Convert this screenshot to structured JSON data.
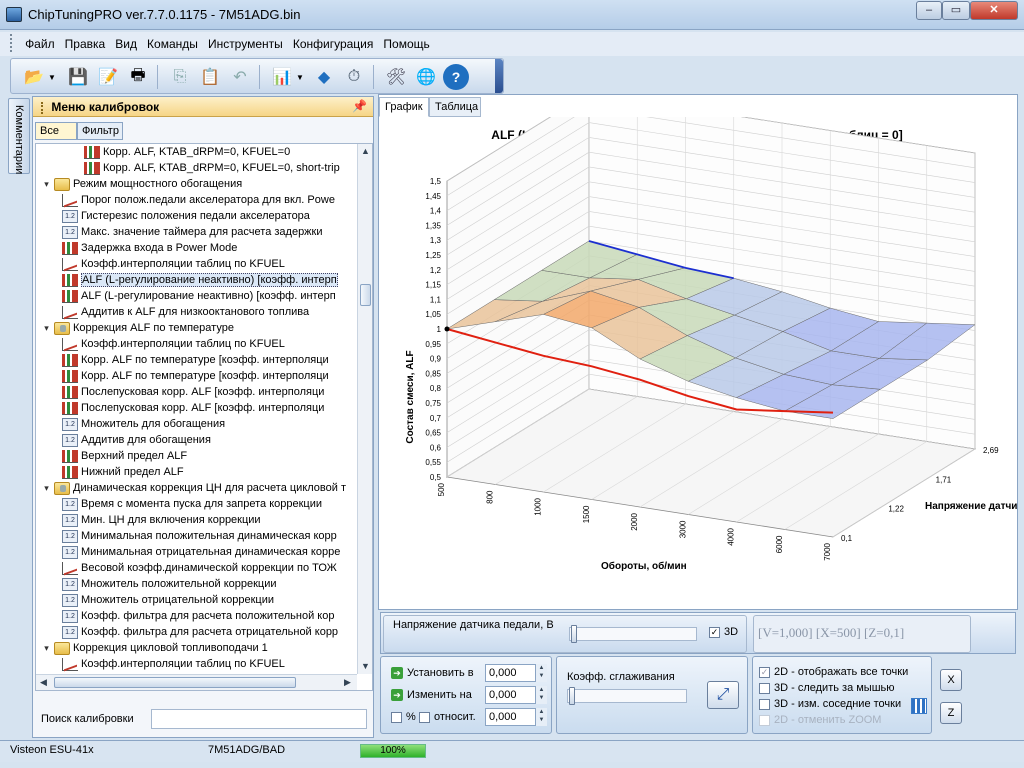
{
  "window": {
    "title": "ChipTuningPRO ver.7.7.0.1175 - 7M51ADG.bin"
  },
  "menu": [
    "Файл",
    "Правка",
    "Вид",
    "Команды",
    "Инструменты",
    "Конфигурация",
    "Помощь"
  ],
  "left_tab": "Комментарии",
  "calib_menu": {
    "title": "Меню калибровок",
    "tabs": [
      "Все",
      "Фильтр"
    ],
    "items": [
      {
        "text": "Корр. ALF, KTAB_dRPM=0, KFUEL=0",
        "icon": "bar-chart-icon",
        "level": 2
      },
      {
        "text": "Корр. ALF, KTAB_dRPM=0, KFUEL=0, short-trip",
        "icon": "bar-chart-icon",
        "level": 2
      },
      {
        "text": "Режим мощностного обогащения",
        "icon": "folder-icon",
        "level": 0,
        "toggle": "-"
      },
      {
        "text": "Порог полож.педали акселератора для вкл. Powe",
        "icon": "graph-icon",
        "level": 1
      },
      {
        "text": "Гистерезис положения педали акселератора",
        "icon": "number-icon",
        "level": 1
      },
      {
        "text": "Макс. значение таймера для расчета задержки",
        "icon": "number-icon",
        "level": 1
      },
      {
        "text": "Задержка входа в Power Mode",
        "icon": "bar-chart-icon",
        "level": 1
      },
      {
        "text": "Коэфф.интерполяции таблиц по KFUEL",
        "icon": "graph-icon",
        "level": 1
      },
      {
        "text": "ALF (L-регулирование неактивно)  [коэфф. интерп",
        "icon": "bar-chart-icon",
        "level": 1,
        "selected": true
      },
      {
        "text": "ALF (L-регулирование неактивно)  [коэфф. интерп",
        "icon": "bar-chart-icon",
        "level": 1
      },
      {
        "text": "Аддитив к ALF для низкооктанового топлива",
        "icon": "graph-icon",
        "level": 1
      },
      {
        "text": "Коррекция ALF по температуре",
        "icon": "folder-db-icon",
        "level": 0,
        "toggle": "-"
      },
      {
        "text": "Коэфф.интерполяции таблиц по KFUEL",
        "icon": "graph-icon",
        "level": 1
      },
      {
        "text": "Корр. ALF по температуре  [коэфф. интерполяци",
        "icon": "bar-chart-icon",
        "level": 1
      },
      {
        "text": "Корр. ALF по температуре  [коэфф. интерполяци",
        "icon": "bar-chart-icon",
        "level": 1
      },
      {
        "text": "Послепусковая корр. ALF  [коэфф. интерполяци",
        "icon": "bar-chart-icon",
        "level": 1
      },
      {
        "text": "Послепусковая корр. ALF  [коэфф. интерполяци",
        "icon": "bar-chart-icon",
        "level": 1
      },
      {
        "text": "Множитель для обогащения",
        "icon": "number-icon",
        "level": 1
      },
      {
        "text": "Аддитив для обогащения",
        "icon": "number-icon",
        "level": 1
      },
      {
        "text": "Верхний предел ALF",
        "icon": "bar-chart-icon",
        "level": 1
      },
      {
        "text": "Нижний предел ALF",
        "icon": "bar-chart-icon",
        "level": 1
      },
      {
        "text": "Динамическая коррекция ЦН для расчета цикловой т",
        "icon": "folder-db-icon",
        "level": 0,
        "toggle": "-"
      },
      {
        "text": "Время с момента пуска для запрета коррекции",
        "icon": "number-icon",
        "level": 1
      },
      {
        "text": "Мин. ЦН для включения коррекции",
        "icon": "number-icon",
        "level": 1
      },
      {
        "text": "Минимальная положительная динамическая корр",
        "icon": "number-icon",
        "level": 1
      },
      {
        "text": "Минимальная отрицательная динамическая корре",
        "icon": "number-icon",
        "level": 1
      },
      {
        "text": "Весовой коэфф.динамической коррекции по ТОЖ",
        "icon": "graph-icon",
        "level": 1
      },
      {
        "text": "Множитель положительной коррекции",
        "icon": "number-icon",
        "level": 1
      },
      {
        "text": "Множитель отрицательной коррекции",
        "icon": "number-icon",
        "level": 1
      },
      {
        "text": "Коэфф. фильтра для расчета  положительной кор",
        "icon": "number-icon",
        "level": 1
      },
      {
        "text": "Коэфф. фильтра для расчета отрицательной корр",
        "icon": "number-icon",
        "level": 1
      },
      {
        "text": "Коррекция цикловой топливоподачи 1",
        "icon": "folder-icon",
        "level": 0,
        "toggle": "-"
      },
      {
        "text": "Коэфф.интерполяции таблиц по KFUEL",
        "icon": "graph-icon",
        "level": 1
      }
    ],
    "search_label": "Поиск калибровки",
    "search_value": ""
  },
  "chart_tabs": [
    "График",
    "Таблица"
  ],
  "chart_data": {
    "type": "surface3d",
    "title": "ALF (L-регулирование неактивно)  [коэфф. интерполяции таблиц = 0]",
    "xlabel": "Обороты, об/мин",
    "ylabel": "Состав смеси, ALF",
    "zlabel": "Напряжение датчика педали, В",
    "x_ticks": [
      "500",
      "800",
      "1000",
      "1500",
      "2000",
      "3000",
      "4000",
      "6000",
      "7000"
    ],
    "y_ticks": [
      "0,5",
      "0,55",
      "0,6",
      "0,65",
      "0,7",
      "0,75",
      "0,8",
      "0,85",
      "0,9",
      "0,95",
      "1",
      "1,05",
      "1,1",
      "1,15",
      "1,2",
      "1,25",
      "1,3",
      "1,35",
      "1,4",
      "1,45",
      "1,5"
    ],
    "z_ticks": [
      "0,1",
      "1,22",
      "1,71",
      "2,69"
    ],
    "ylim": [
      0.5,
      1.5
    ],
    "surface_rows": [
      [
        1.0,
        1.05,
        1.1,
        1.08,
        1.0,
        0.95,
        0.92,
        0.9,
        0.9
      ],
      [
        1.0,
        1.02,
        1.08,
        1.05,
        0.98,
        0.93,
        0.9,
        0.89,
        0.9
      ],
      [
        1.0,
        1.0,
        1.02,
        0.98,
        0.95,
        0.92,
        0.88,
        0.88,
        0.9
      ],
      [
        1.0,
        0.98,
        0.96,
        0.95,
        0.93,
        0.9,
        0.88,
        0.9,
        0.92
      ]
    ],
    "highlight_line": {
      "name": "",
      "values": [
        1.0,
        0.98,
        0.96,
        0.95,
        0.93,
        0.9,
        0.88,
        0.9,
        0.92
      ]
    }
  },
  "controls": {
    "pedal_label": "Напряжение датчика педали, В",
    "check_3d": "3D",
    "readout": "[V=1,000]  [X=500]  [Z=0,1]",
    "set_label": "Установить в",
    "change_label": "Изменить на",
    "set_value": "0,000",
    "change_value": "0,000",
    "pct_label": "%",
    "rel_label": "относит.",
    "rel_value": "0,000",
    "smooth_label": "Коэфф. сглаживания",
    "opt1": "2D - отображать все точки",
    "opt2": "3D - следить за мышью",
    "opt3": "3D - изм. соседние точки",
    "opt4": "2D - отменить ZOOM",
    "btn_x": "X",
    "btn_z": "Z"
  },
  "status": {
    "ecu": "Visteon ESU-41x",
    "file": "7M51ADG/BAD",
    "progress": "100%"
  }
}
